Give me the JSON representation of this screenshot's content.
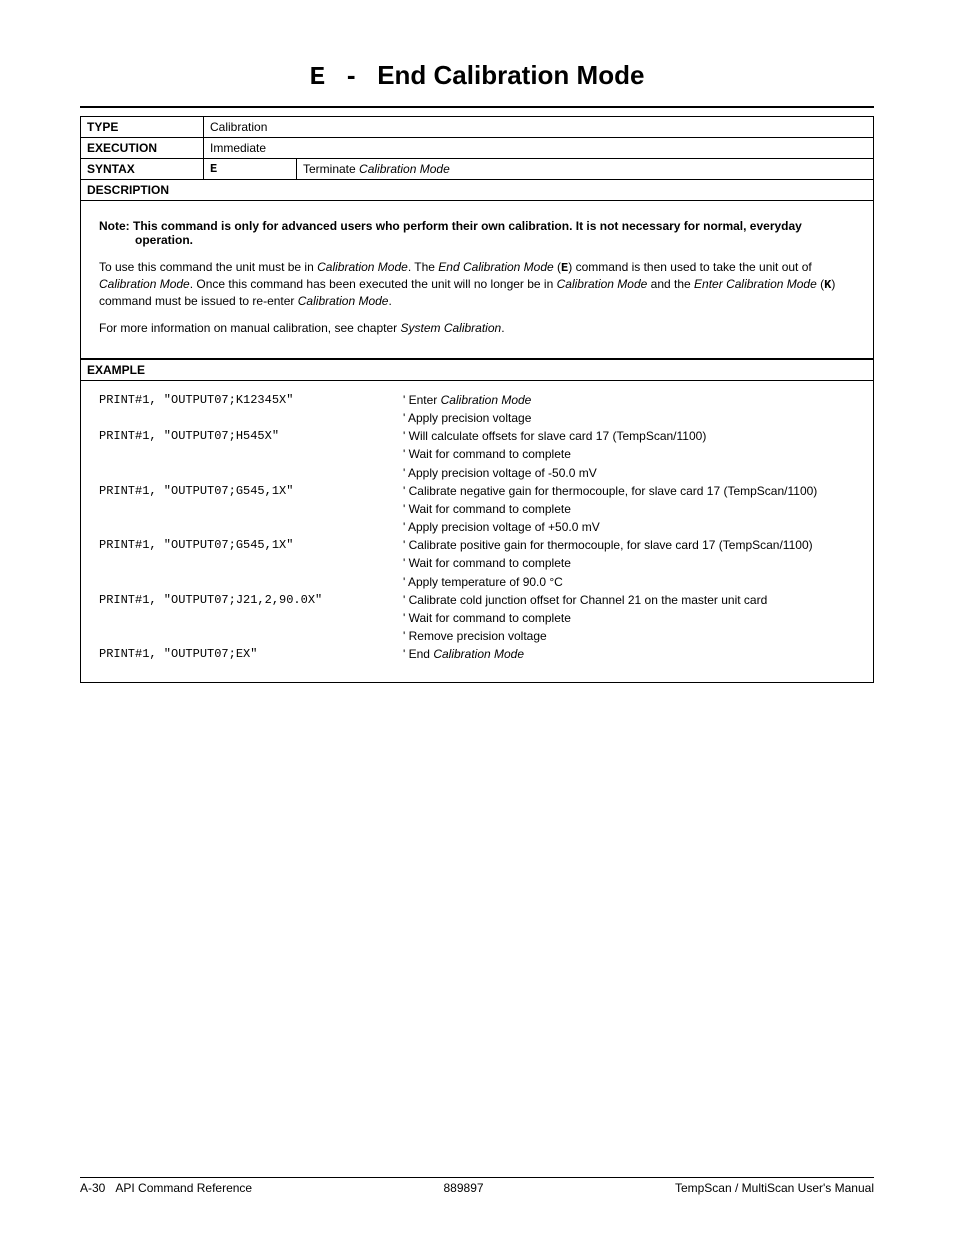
{
  "title": {
    "cmd": "E",
    "sep": "-",
    "text": "End Calibration Mode"
  },
  "spec": {
    "type_label": "TYPE",
    "type_val": "Calibration",
    "exec_label": "EXECUTION",
    "exec_val": "Immediate",
    "syntax_label": "SYNTAX",
    "syntax_code": "E",
    "syntax_desc_pre": "Terminate ",
    "syntax_desc_ital": "Calibration Mode",
    "desc_label": "DESCRIPTION"
  },
  "note": "Note:  This command is only for advanced users who perform their own calibration.  It is not necessary for normal, everyday operation.",
  "para1": {
    "t1": "To use this command the unit must be in ",
    "i1": "Calibration Mode",
    "t2": ".  The ",
    "i2": "End Calibration Mode",
    "t3": " (",
    "c1": "E",
    "t4": ") command is then used to take the unit out of ",
    "i3": "Calibration Mode",
    "t5": ".  Once this command has been executed the unit will no longer be in ",
    "i4": "Calibration Mode",
    "t6": " and the ",
    "i5": "Enter Calibration Mode",
    "t7": " (",
    "c2": "K",
    "t8": ") command must be issued to re-enter ",
    "i6": "Calibration Mode",
    "t9": "."
  },
  "para2": {
    "t1": "For more information on manual calibration, see chapter ",
    "i1": "System Calibration",
    "t2": "."
  },
  "example_label": "EXAMPLE",
  "examples": [
    {
      "code": "PRINT#1, \"OUTPUT07;K12345X\"",
      "pre": "' Enter ",
      "ital": "Calibration Mode"
    },
    {
      "code": "",
      "pre": "' Apply precision voltage",
      "ital": ""
    },
    {
      "code": "PRINT#1, \"OUTPUT07;H545X\"",
      "pre": "' Will calculate offsets for slave card 17 (TempScan/1100)",
      "ital": ""
    },
    {
      "code": "",
      "pre": "' Wait for command to complete",
      "ital": ""
    },
    {
      "code": "",
      "pre": "' Apply precision voltage of -50.0 mV",
      "ital": ""
    },
    {
      "code": "PRINT#1, \"OUTPUT07;G545,1X\"",
      "pre": "' Calibrate negative gain for thermocouple, for slave card 17 (TempScan/1100)",
      "ital": ""
    },
    {
      "code": "",
      "pre": "' Wait for command to complete",
      "ital": ""
    },
    {
      "code": "",
      "pre": "' Apply precision voltage of +50.0 mV",
      "ital": ""
    },
    {
      "code": "PRINT#1, \"OUTPUT07;G545,1X\"",
      "pre": "' Calibrate positive gain for thermocouple, for slave card 17 (TempScan/1100)",
      "ital": ""
    },
    {
      "code": "",
      "pre": "' Wait for command to complete",
      "ital": ""
    },
    {
      "code": "",
      "pre": "' Apply temperature of 90.0 °C",
      "ital": ""
    },
    {
      "code": "PRINT#1, \"OUTPUT07;J21,2,90.0X\"",
      "pre": "' Calibrate cold junction offset for Channel 21 on the master unit card",
      "ital": ""
    },
    {
      "code": "",
      "pre": "' Wait for command to complete",
      "ital": ""
    },
    {
      "code": "",
      "pre": "' Remove precision voltage",
      "ital": ""
    },
    {
      "code": "PRINT#1, \"OUTPUT07;EX\"",
      "pre": "' End ",
      "ital": "Calibration Mode"
    }
  ],
  "footer": {
    "left_pre": "A-30   ",
    "left_text": "API Command Reference",
    "center": "889897",
    "right": "TempScan / MultiScan User's Manual"
  }
}
